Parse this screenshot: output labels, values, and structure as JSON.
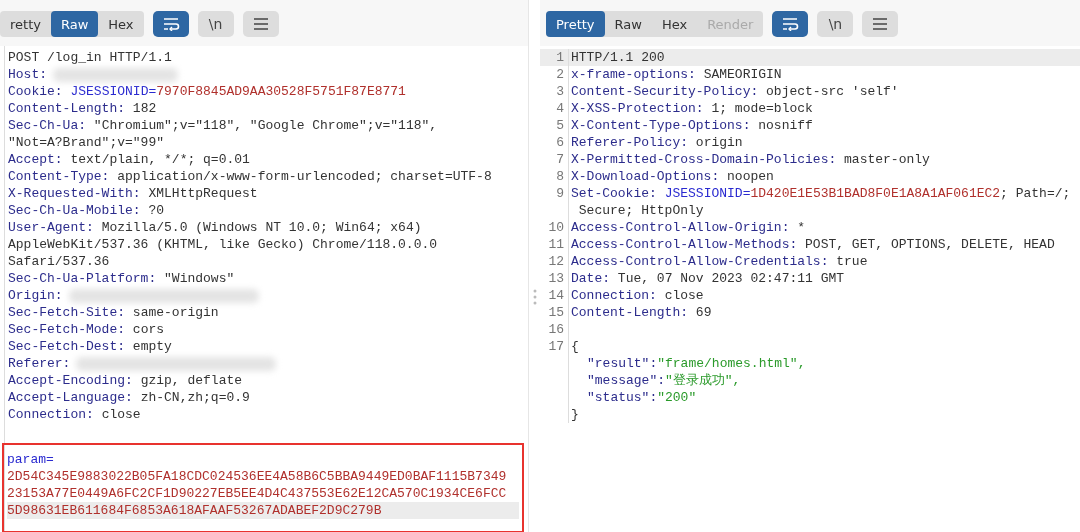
{
  "request": {
    "tabs": [
      {
        "label": "retty",
        "selected": false,
        "disabled": false
      },
      {
        "label": "Raw",
        "selected": true,
        "disabled": false
      },
      {
        "label": "Hex",
        "selected": false,
        "disabled": false
      }
    ],
    "tools": [
      {
        "kind": "wrap",
        "selected": true
      },
      {
        "kind": "newline",
        "label": "\\n",
        "selected": false
      },
      {
        "kind": "menu",
        "selected": false
      }
    ],
    "lines": [
      {
        "kind": "plain",
        "text": "POST /log_in HTTP/1.1",
        "highlighted": false
      },
      {
        "kind": "redacted",
        "name": "Host:",
        "highlighted": false
      },
      {
        "kind": "cookie",
        "name": "Cookie:",
        "key": "JSESSIONID=",
        "value": "7970F8845AD9AA30528F5751F87E8771",
        "highlighted": false
      },
      {
        "kind": "header",
        "name": "Content-Length:",
        "value": "182",
        "highlighted": false
      },
      {
        "kind": "header",
        "name": "Sec-Ch-Ua:",
        "value": "\"Chromium\";v=\"118\", \"Google Chrome\";v=\"118\",",
        "highlighted": false
      },
      {
        "kind": "plain",
        "text": "\"Not=A?Brand\";v=\"99\"",
        "highlighted": false
      },
      {
        "kind": "header",
        "name": "Accept:",
        "value": "text/plain, */*; q=0.01",
        "highlighted": false
      },
      {
        "kind": "header",
        "name": "Content-Type:",
        "value": "application/x-www-form-urlencoded; charset=UTF-8",
        "highlighted": false
      },
      {
        "kind": "header",
        "name": "X-Requested-With:",
        "value": "XMLHttpRequest",
        "highlighted": false
      },
      {
        "kind": "header",
        "name": "Sec-Ch-Ua-Mobile:",
        "value": "?0",
        "highlighted": false
      },
      {
        "kind": "header",
        "name": "User-Agent:",
        "value": "Mozilla/5.0 (Windows NT 10.0; Win64; x64)",
        "highlighted": false
      },
      {
        "kind": "plain",
        "text": "AppleWebKit/537.36 (KHTML, like Gecko) Chrome/118.0.0.0",
        "highlighted": false
      },
      {
        "kind": "plain",
        "text": "Safari/537.36",
        "highlighted": false
      },
      {
        "kind": "header",
        "name": "Sec-Ch-Ua-Platform:",
        "value": "\"Windows\"",
        "highlighted": false
      },
      {
        "kind": "redacted",
        "name": "Origin:",
        "highlighted": false
      },
      {
        "kind": "header",
        "name": "Sec-Fetch-Site:",
        "value": "same-origin",
        "highlighted": false
      },
      {
        "kind": "header",
        "name": "Sec-Fetch-Mode:",
        "value": "cors",
        "highlighted": false
      },
      {
        "kind": "header",
        "name": "Sec-Fetch-Dest:",
        "value": "empty",
        "highlighted": false
      },
      {
        "kind": "redacted",
        "name": "Referer:",
        "highlighted": false
      },
      {
        "kind": "header",
        "name": "Accept-Encoding:",
        "value": "gzip, deflate",
        "highlighted": false
      },
      {
        "kind": "header",
        "name": "Accept-Language:",
        "value": "zh-CN,zh;q=0.9",
        "highlighted": false
      },
      {
        "kind": "header",
        "name": "Connection:",
        "value": "close",
        "highlighted": false
      }
    ],
    "body": {
      "outlined": true,
      "name": "param=",
      "lines": [
        {
          "text": "2D54C345E9883022B05FA18CDC024536EE4A58B6C5BBA9449ED0BAF1115B7349",
          "highlighted": false
        },
        {
          "text": "23153A77E0449A6FC2CF1D90227EB5EE4D4C437553E62E12CA570C1934CE6FCC",
          "highlighted": false
        },
        {
          "text": "5D98631EB611684F6853A618AFAAF53267ADABEF2D9C279B",
          "highlighted": true
        }
      ]
    }
  },
  "response": {
    "tabs": [
      {
        "label": "Pretty",
        "selected": true,
        "disabled": false
      },
      {
        "label": "Raw",
        "selected": false,
        "disabled": false
      },
      {
        "label": "Hex",
        "selected": false,
        "disabled": false
      },
      {
        "label": "Render",
        "selected": false,
        "disabled": true
      }
    ],
    "tools": [
      {
        "kind": "wrap",
        "selected": true
      },
      {
        "kind": "newline",
        "label": "\\n",
        "selected": false
      },
      {
        "kind": "menu",
        "selected": false
      }
    ],
    "lines": [
      {
        "number": "1",
        "kind": "plain",
        "text": "HTTP/1.1 200",
        "highlighted": true
      },
      {
        "number": "2",
        "kind": "header",
        "name": "x-frame-options:",
        "value": "SAMEORIGIN",
        "highlighted": false
      },
      {
        "number": "3",
        "kind": "header",
        "name": "Content-Security-Policy:",
        "value": "object-src 'self'",
        "highlighted": false
      },
      {
        "number": "4",
        "kind": "header",
        "name": "X-XSS-Protection:",
        "value": "1; mode=block",
        "highlighted": false
      },
      {
        "number": "5",
        "kind": "header",
        "name": "X-Content-Type-Options:",
        "value": "nosniff",
        "highlighted": false
      },
      {
        "number": "6",
        "kind": "header",
        "name": "Referer-Policy:",
        "value": "origin",
        "highlighted": false
      },
      {
        "number": "7",
        "kind": "header",
        "name": "X-Permitted-Cross-Domain-Policies:",
        "value": "master-only",
        "highlighted": false
      },
      {
        "number": "8",
        "kind": "header",
        "name": "X-Download-Options:",
        "value": "noopen",
        "highlighted": false
      },
      {
        "number": "9",
        "kind": "cookie",
        "name": "Set-Cookie:",
        "key": "JSESSIONID=",
        "value": "1D420E1E53B1BAD8F0E1A8A1AF061EC2",
        "suffix": "; Path=/;",
        "highlighted": false
      },
      {
        "kind": "plain",
        "text": " Secure; HttpOnly",
        "highlighted": false
      },
      {
        "number": "10",
        "kind": "header",
        "name": "Access-Control-Allow-Origin:",
        "value": "*",
        "highlighted": false
      },
      {
        "number": "11",
        "kind": "header",
        "name": "Access-Control-Allow-Methods:",
        "value": "POST, GET, OPTIONS, DELETE, HEAD",
        "highlighted": false
      },
      {
        "number": "12",
        "kind": "header",
        "name": "Access-Control-Allow-Credentials:",
        "value": "true",
        "highlighted": false
      },
      {
        "number": "13",
        "kind": "header",
        "name": "Date:",
        "value": "Tue, 07 Nov 2023 02:47:11 GMT",
        "highlighted": false
      },
      {
        "number": "14",
        "kind": "header",
        "name": "Connection:",
        "value": "close",
        "highlighted": false
      },
      {
        "number": "15",
        "kind": "header",
        "name": "Content-Length:",
        "value": "69",
        "highlighted": false
      },
      {
        "number": "16",
        "kind": "blank",
        "highlighted": false
      },
      {
        "number": "17",
        "kind": "plain",
        "text": "{",
        "highlighted": false
      },
      {
        "kind": "json",
        "key": "\"result\":",
        "value": "\"frame/homes.html\",",
        "highlighted": false
      },
      {
        "kind": "json",
        "key": "\"message\":",
        "value": "\"登录成功\",",
        "highlighted": false
      },
      {
        "kind": "json",
        "key": "\"status\":",
        "value": "\"200\"",
        "highlighted": false
      },
      {
        "kind": "plain",
        "text": "}",
        "highlighted": false
      }
    ]
  }
}
